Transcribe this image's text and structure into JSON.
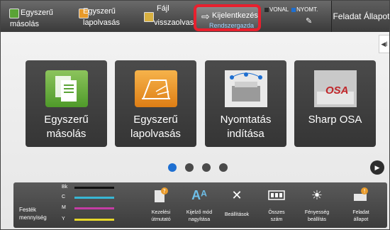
{
  "topbar": {
    "copy_l1": "Egyszerű",
    "copy_l2": "másolás",
    "scan_l1": "Egyszerű",
    "scan_l2": "lapolvasás",
    "file_l1": "Fájl",
    "file_l2": "visszaolvasás",
    "logout_label": "Kijelentkezés",
    "logout_sub": "Rendszergazda",
    "status_vonal": "VONAL",
    "status_nyomt": "NYOMT.",
    "job_status": "Feladat Állapot"
  },
  "tiles": [
    {
      "l1": "Egyszerű",
      "l2": "másolás"
    },
    {
      "l1": "Egyszerű",
      "l2": "lapolvasás"
    },
    {
      "l1": "Nyomtatás",
      "l2": "indítása"
    },
    {
      "l1": "Sharp OSA",
      "l2": ""
    }
  ],
  "osa_logo": "OSA",
  "pager": {
    "current": 1,
    "total": 4
  },
  "toner": {
    "title_l1": "Festék",
    "title_l2": "mennyiség",
    "colors": [
      {
        "key": "Bk",
        "color": "#111111"
      },
      {
        "key": "C",
        "color": "#38b7d4"
      },
      {
        "key": "M",
        "color": "#c43ca4"
      },
      {
        "key": "Y",
        "color": "#e6d62c"
      }
    ]
  },
  "bottom_buttons": [
    {
      "l1": "Kezelési",
      "l2": "útmutató",
      "icon": "manual-icon"
    },
    {
      "l1": "Kijelző mód",
      "l2": "nagyítása",
      "icon": "zoom-text-icon"
    },
    {
      "l1": "Beállítások",
      "l2": "",
      "icon": "tools-icon"
    },
    {
      "l1": "Összes",
      "l2": "szám",
      "icon": "counter-icon"
    },
    {
      "l1": "Fényesség",
      "l2": "beállítás",
      "icon": "brightness-icon"
    },
    {
      "l1": "Feladat",
      "l2": "állapot",
      "icon": "job-status-icon"
    }
  ],
  "colors": {
    "highlight": "#e8202e",
    "accent_blue": "#1e6fd1"
  }
}
